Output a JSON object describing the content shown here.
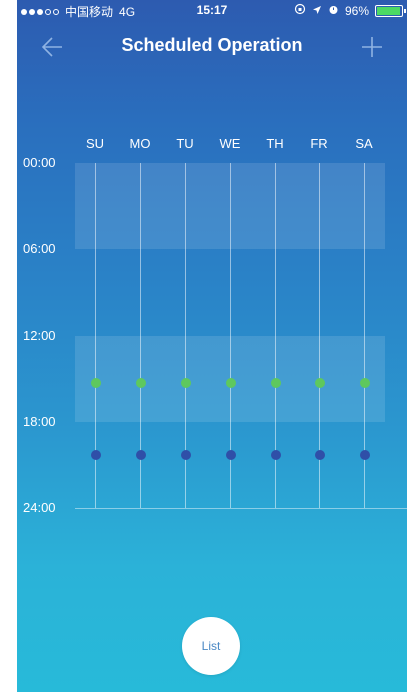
{
  "status_bar": {
    "carrier": "中国移动",
    "network": "4G",
    "time": "15:17",
    "battery_percent": "96%",
    "battery_level": 0.96
  },
  "nav": {
    "title": "Scheduled Operation",
    "back_icon": "arrow-left-icon",
    "add_icon": "plus-icon"
  },
  "days": [
    "SU",
    "MO",
    "TU",
    "WE",
    "TH",
    "FR",
    "SA"
  ],
  "time_labels": [
    "00:00",
    "06:00",
    "12:00",
    "18:00",
    "24:00"
  ],
  "schedule": {
    "on_time_color": "#5ec85e",
    "off_time_color": "#2f4fa8"
  },
  "footer": {
    "list_label": "List"
  }
}
